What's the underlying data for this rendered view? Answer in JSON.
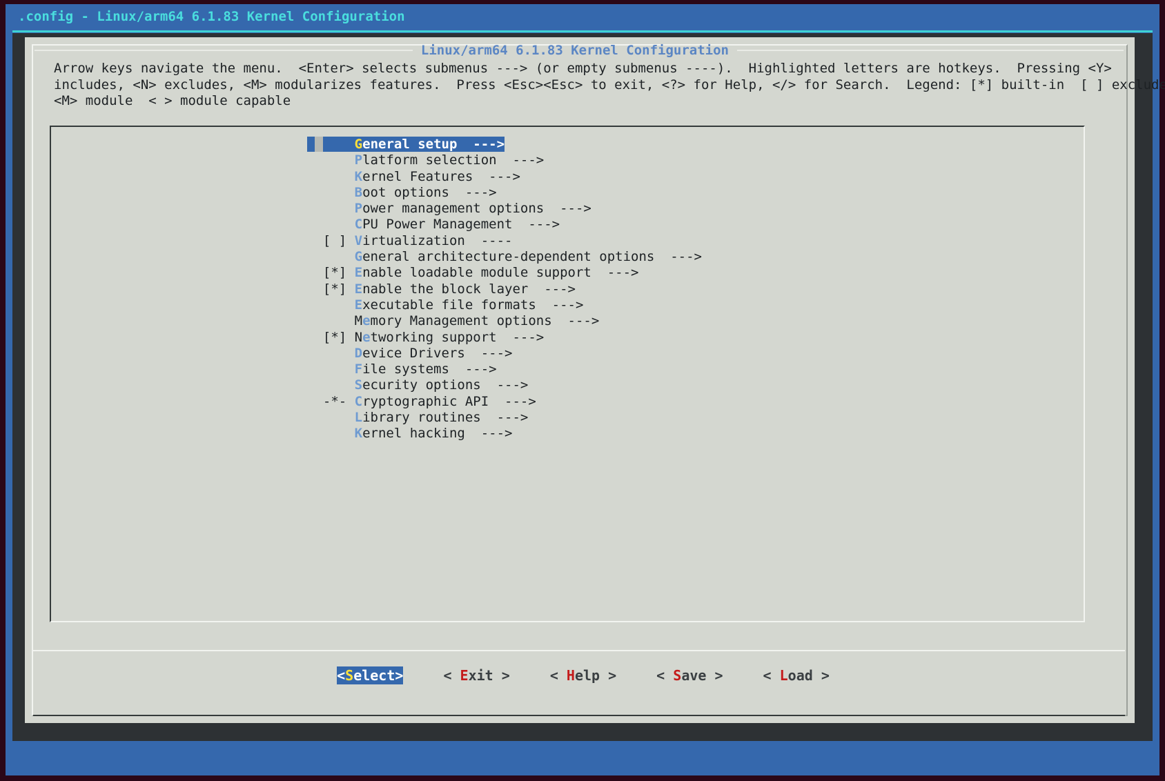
{
  "window": {
    "title": ".config - Linux/arm64 6.1.83 Kernel Configuration"
  },
  "dialog": {
    "title": "Linux/arm64 6.1.83 Kernel Configuration",
    "help_text": "Arrow keys navigate the menu.  <Enter> selects submenus ---> (or empty submenus ----).  Highlighted letters are hotkeys.  Pressing <Y>\nincludes, <N> excludes, <M> modularizes features.  Press <Esc><Esc> to exit, <?> for Help, </> for Search.  Legend: [*] built-in  [ ] excluded\n<M> module  < > module capable"
  },
  "menu": {
    "selected_index": 0,
    "items": [
      {
        "prefix": "    ",
        "hot": "G",
        "rest": "eneral setup  --->",
        "selected": true
      },
      {
        "prefix": "    ",
        "hot": "P",
        "rest": "latform selection  --->",
        "selected": false
      },
      {
        "prefix": "    ",
        "hot": "K",
        "rest": "ernel Features  --->",
        "selected": false
      },
      {
        "prefix": "    ",
        "hot": "B",
        "rest": "oot options  --->",
        "selected": false
      },
      {
        "prefix": "    ",
        "hot": "P",
        "rest": "ower management options  --->",
        "selected": false
      },
      {
        "prefix": "    ",
        "hot": "C",
        "rest": "PU Power Management  --->",
        "selected": false
      },
      {
        "prefix": "[ ] ",
        "hot": "V",
        "rest": "irtualization  ----",
        "selected": false
      },
      {
        "prefix": "    ",
        "hot": "G",
        "rest": "eneral architecture-dependent options  --->",
        "selected": false
      },
      {
        "prefix": "[*] ",
        "hot": "E",
        "rest": "nable loadable module support  --->",
        "selected": false
      },
      {
        "prefix": "[*] ",
        "hot": "E",
        "rest": "nable the block layer  --->",
        "selected": false
      },
      {
        "prefix": "    ",
        "hot": "E",
        "rest": "xecutable file formats  --->",
        "selected": false
      },
      {
        "prefix": "    M",
        "hot": "e",
        "rest": "mory Management options  --->",
        "selected": false
      },
      {
        "prefix": "[*] N",
        "hot": "e",
        "rest": "tworking support  --->",
        "selected": false
      },
      {
        "prefix": "    ",
        "hot": "D",
        "rest": "evice Drivers  --->",
        "selected": false
      },
      {
        "prefix": "    ",
        "hot": "F",
        "rest": "ile systems  --->",
        "selected": false
      },
      {
        "prefix": "    ",
        "hot": "S",
        "rest": "ecurity options  --->",
        "selected": false
      },
      {
        "prefix": "-*- ",
        "hot": "C",
        "rest": "ryptographic API  --->",
        "selected": false
      },
      {
        "prefix": "    ",
        "hot": "L",
        "rest": "ibrary routines  --->",
        "selected": false
      },
      {
        "prefix": "    ",
        "hot": "K",
        "rest": "ernel hacking  --->",
        "selected": false
      }
    ]
  },
  "buttons": [
    {
      "open": "<",
      "hot": "S",
      "rest": "elect",
      "close": ">",
      "active": true
    },
    {
      "open": "< ",
      "hot": "E",
      "rest": "xit",
      "close": " >",
      "active": false
    },
    {
      "open": "< ",
      "hot": "H",
      "rest": "elp",
      "close": " >",
      "active": false
    },
    {
      "open": "< ",
      "hot": "S",
      "rest": "ave",
      "close": " >",
      "active": false
    },
    {
      "open": "< ",
      "hot": "L",
      "rest": "oad",
      "close": " >",
      "active": false
    }
  ],
  "colors": {
    "desktop_blue": "#3568ad",
    "terminal_bg": "#2d3134",
    "dialog_bg": "#d4d7d0",
    "title_cyan": "#4adede",
    "dialog_title_blue": "#5b86c4",
    "hotkey_blue": "#6f9bd1",
    "hotkey_yellow": "#ffe13a",
    "button_hotkey_red": "#c41b1b",
    "selection_blue": "#3568ad"
  }
}
